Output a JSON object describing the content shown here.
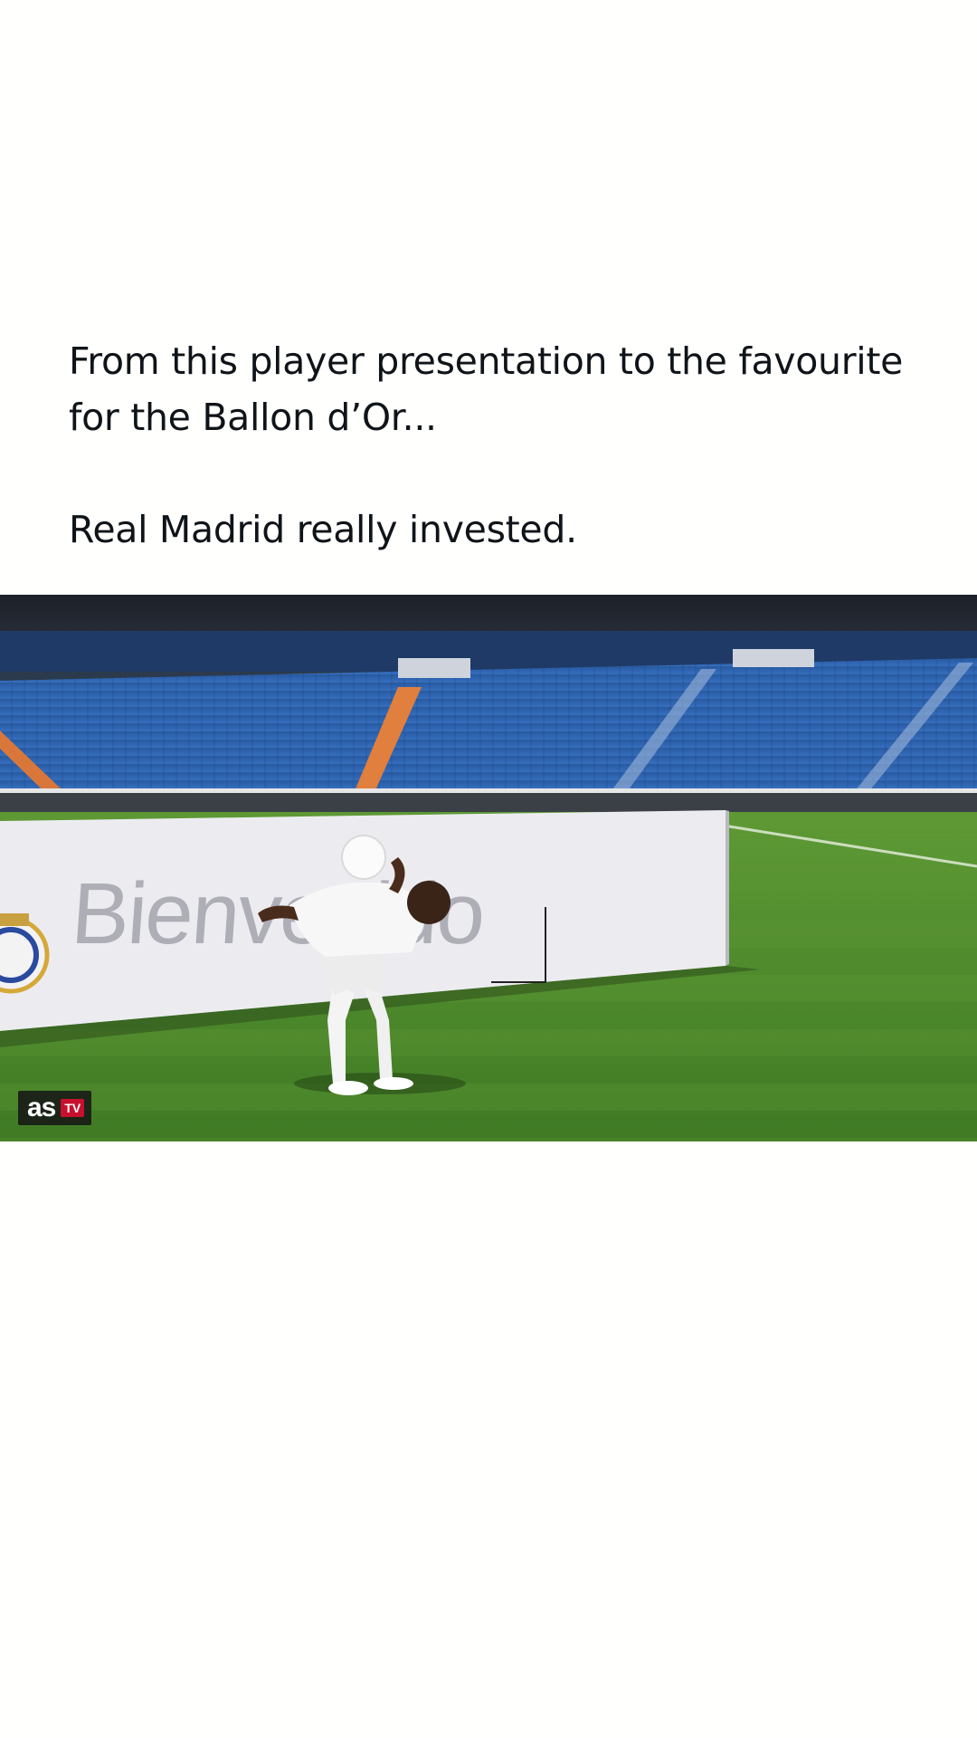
{
  "post": {
    "line1": "From this player presentation to the favourite",
    "line2": "for the Ballon d’Or...",
    "line3": "Real Madrid really invested."
  },
  "video": {
    "banner_text": "Bienvenido",
    "watermark_brand": "as",
    "watermark_tv": "TV"
  },
  "colors": {
    "page_background": "#fffffd",
    "caption_text": "#0f1419",
    "stadium_seats": "#2f66b3",
    "pitch": "#4f8a2d",
    "banner": "#e9e9ee"
  }
}
